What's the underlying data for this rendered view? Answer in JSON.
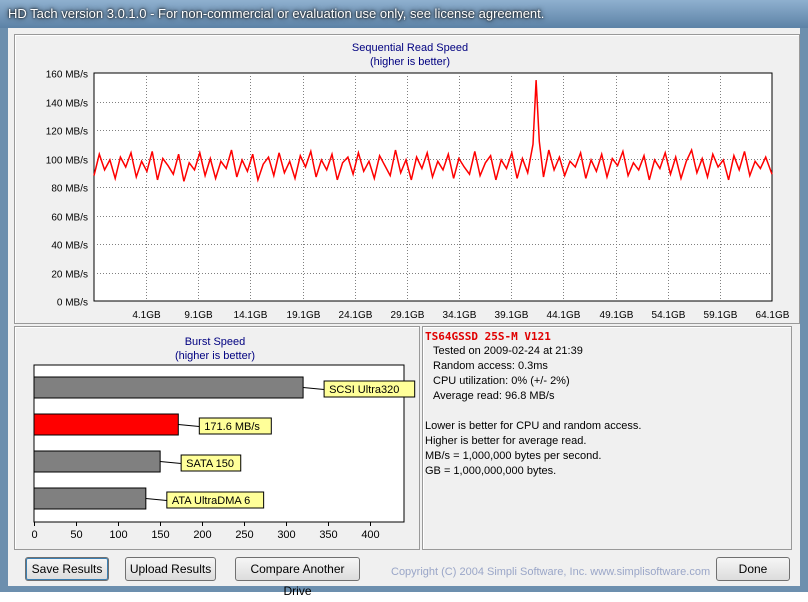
{
  "window": {
    "title": "HD Tach version 3.0.1.0  - For non-commercial or evaluation use only, see license agreement."
  },
  "seq_chart": {
    "title": "Sequential Read Speed",
    "subtitle": "(higher is better)"
  },
  "burst_chart": {
    "title": "Burst Speed",
    "subtitle": "(higher is better)"
  },
  "chart_data": [
    {
      "type": "line",
      "title": "Sequential Read Speed",
      "subtitle": "(higher is better)",
      "ylabel": "MB/s",
      "y_tick_labels": [
        "160 MB/s",
        "140 MB/s",
        "120 MB/s",
        "100 MB/s",
        "80 MB/s",
        "60 MB/s",
        "40 MB/s",
        "20 MB/s",
        "0 MB/s"
      ],
      "x_tick_labels": [
        "4.1GB",
        "9.1GB",
        "14.1GB",
        "19.1GB",
        "24.1GB",
        "29.1GB",
        "34.1GB",
        "39.1GB",
        "44.1GB",
        "49.1GB",
        "54.1GB",
        "59.1GB",
        "64.1GB"
      ],
      "ylim": [
        0,
        160
      ],
      "xlim": [
        0,
        64.1
      ],
      "grid": true,
      "series": [
        {
          "color": "#ff0000",
          "x_unit": "GB",
          "values": [
            {
              "x": 0.0,
              "y": 88
            },
            {
              "x": 0.5,
              "y": 103
            },
            {
              "x": 1.0,
              "y": 92
            },
            {
              "x": 1.5,
              "y": 99
            },
            {
              "x": 2.0,
              "y": 86
            },
            {
              "x": 2.5,
              "y": 101
            },
            {
              "x": 3.0,
              "y": 94
            },
            {
              "x": 3.5,
              "y": 104
            },
            {
              "x": 4.0,
              "y": 87
            },
            {
              "x": 4.5,
              "y": 98
            },
            {
              "x": 5.0,
              "y": 91
            },
            {
              "x": 5.5,
              "y": 105
            },
            {
              "x": 6.0,
              "y": 85
            },
            {
              "x": 6.5,
              "y": 100
            },
            {
              "x": 7.0,
              "y": 95
            },
            {
              "x": 7.5,
              "y": 89
            },
            {
              "x": 8.0,
              "y": 103
            },
            {
              "x": 8.5,
              "y": 84
            },
            {
              "x": 9.0,
              "y": 97
            },
            {
              "x": 9.5,
              "y": 92
            },
            {
              "x": 10.0,
              "y": 104
            },
            {
              "x": 10.5,
              "y": 88
            },
            {
              "x": 11.0,
              "y": 100
            },
            {
              "x": 11.5,
              "y": 86
            },
            {
              "x": 12.0,
              "y": 98
            },
            {
              "x": 12.5,
              "y": 93
            },
            {
              "x": 13.0,
              "y": 106
            },
            {
              "x": 13.5,
              "y": 87
            },
            {
              "x": 14.0,
              "y": 99
            },
            {
              "x": 14.5,
              "y": 91
            },
            {
              "x": 15.0,
              "y": 103
            },
            {
              "x": 15.5,
              "y": 85
            },
            {
              "x": 16.0,
              "y": 96
            },
            {
              "x": 16.5,
              "y": 101
            },
            {
              "x": 17.0,
              "y": 88
            },
            {
              "x": 17.5,
              "y": 104
            },
            {
              "x": 18.0,
              "y": 90
            },
            {
              "x": 18.5,
              "y": 98
            },
            {
              "x": 19.0,
              "y": 86
            },
            {
              "x": 19.5,
              "y": 102
            },
            {
              "x": 20.0,
              "y": 94
            },
            {
              "x": 20.5,
              "y": 105
            },
            {
              "x": 21.0,
              "y": 87
            },
            {
              "x": 21.5,
              "y": 99
            },
            {
              "x": 22.0,
              "y": 92
            },
            {
              "x": 22.5,
              "y": 103
            },
            {
              "x": 23.0,
              "y": 85
            },
            {
              "x": 23.5,
              "y": 97
            },
            {
              "x": 24.0,
              "y": 101
            },
            {
              "x": 24.5,
              "y": 89
            },
            {
              "x": 25.0,
              "y": 104
            },
            {
              "x": 25.5,
              "y": 91
            },
            {
              "x": 26.0,
              "y": 98
            },
            {
              "x": 26.5,
              "y": 86
            },
            {
              "x": 27.0,
              "y": 102
            },
            {
              "x": 27.5,
              "y": 95
            },
            {
              "x": 28.0,
              "y": 88
            },
            {
              "x": 28.5,
              "y": 106
            },
            {
              "x": 29.0,
              "y": 90
            },
            {
              "x": 29.5,
              "y": 99
            },
            {
              "x": 30.0,
              "y": 85
            },
            {
              "x": 30.5,
              "y": 101
            },
            {
              "x": 31.0,
              "y": 93
            },
            {
              "x": 31.5,
              "y": 104
            },
            {
              "x": 32.0,
              "y": 87
            },
            {
              "x": 32.5,
              "y": 98
            },
            {
              "x": 33.0,
              "y": 92
            },
            {
              "x": 33.5,
              "y": 103
            },
            {
              "x": 34.0,
              "y": 86
            },
            {
              "x": 34.5,
              "y": 100
            },
            {
              "x": 35.0,
              "y": 94
            },
            {
              "x": 35.5,
              "y": 89
            },
            {
              "x": 36.0,
              "y": 105
            },
            {
              "x": 36.5,
              "y": 88
            },
            {
              "x": 37.0,
              "y": 97
            },
            {
              "x": 37.5,
              "y": 102
            },
            {
              "x": 38.0,
              "y": 85
            },
            {
              "x": 38.5,
              "y": 99
            },
            {
              "x": 39.0,
              "y": 93
            },
            {
              "x": 39.5,
              "y": 104
            },
            {
              "x": 40.0,
              "y": 86
            },
            {
              "x": 40.5,
              "y": 100
            },
            {
              "x": 41.0,
              "y": 90
            },
            {
              "x": 41.5,
              "y": 110
            },
            {
              "x": 41.8,
              "y": 155
            },
            {
              "x": 42.1,
              "y": 112
            },
            {
              "x": 42.5,
              "y": 87
            },
            {
              "x": 43.0,
              "y": 106
            },
            {
              "x": 43.5,
              "y": 92
            },
            {
              "x": 44.0,
              "y": 101
            },
            {
              "x": 44.5,
              "y": 88
            },
            {
              "x": 45.0,
              "y": 98
            },
            {
              "x": 45.5,
              "y": 94
            },
            {
              "x": 46.0,
              "y": 104
            },
            {
              "x": 46.5,
              "y": 86
            },
            {
              "x": 47.0,
              "y": 99
            },
            {
              "x": 47.5,
              "y": 91
            },
            {
              "x": 48.0,
              "y": 103
            },
            {
              "x": 48.5,
              "y": 87
            },
            {
              "x": 49.0,
              "y": 100
            },
            {
              "x": 49.5,
              "y": 95
            },
            {
              "x": 50.0,
              "y": 105
            },
            {
              "x": 50.5,
              "y": 88
            },
            {
              "x": 51.0,
              "y": 97
            },
            {
              "x": 51.5,
              "y": 92
            },
            {
              "x": 52.0,
              "y": 102
            },
            {
              "x": 52.5,
              "y": 85
            },
            {
              "x": 53.0,
              "y": 99
            },
            {
              "x": 53.5,
              "y": 93
            },
            {
              "x": 54.0,
              "y": 104
            },
            {
              "x": 54.5,
              "y": 89
            },
            {
              "x": 55.0,
              "y": 101
            },
            {
              "x": 55.5,
              "y": 86
            },
            {
              "x": 56.0,
              "y": 98
            },
            {
              "x": 56.5,
              "y": 106
            },
            {
              "x": 57.0,
              "y": 90
            },
            {
              "x": 57.5,
              "y": 100
            },
            {
              "x": 58.0,
              "y": 87
            },
            {
              "x": 58.5,
              "y": 103
            },
            {
              "x": 59.0,
              "y": 94
            },
            {
              "x": 59.5,
              "y": 99
            },
            {
              "x": 60.0,
              "y": 85
            },
            {
              "x": 60.5,
              "y": 102
            },
            {
              "x": 61.0,
              "y": 92
            },
            {
              "x": 61.5,
              "y": 105
            },
            {
              "x": 62.0,
              "y": 88
            },
            {
              "x": 62.5,
              "y": 98
            },
            {
              "x": 63.0,
              "y": 93
            },
            {
              "x": 63.5,
              "y": 101
            },
            {
              "x": 64.1,
              "y": 89
            }
          ]
        }
      ]
    },
    {
      "type": "bar",
      "orientation": "horizontal",
      "title": "Burst Speed",
      "subtitle": "(higher is better)",
      "x_tick_labels": [
        "0",
        "50",
        "100",
        "150",
        "200",
        "250",
        "300",
        "350",
        "400"
      ],
      "xlim": [
        0,
        440
      ],
      "grid": false,
      "bars": [
        {
          "label": "SCSI Ultra320",
          "value": 320,
          "color": "#808080"
        },
        {
          "label": "171.6 MB/s",
          "value": 171.6,
          "color": "#ff0000"
        },
        {
          "label": "SATA 150",
          "value": 150,
          "color": "#808080"
        },
        {
          "label": "ATA UltraDMA 6",
          "value": 133,
          "color": "#808080"
        }
      ]
    }
  ],
  "info": {
    "drive_name": "TS64GSSD 25S-M V121",
    "tested_on": "Tested on 2009-02-24 at 21:39",
    "random_access": "Random access: 0.3ms",
    "cpu_util": "CPU utilization: 0% (+/- 2%)",
    "avg_read": "Average read: 96.8 MB/s",
    "note1": "Lower is better for CPU and random access.",
    "note2": "Higher is better for average read.",
    "note3": "MB/s = 1,000,000 bytes per second.",
    "note4": "GB = 1,000,000,000 bytes."
  },
  "buttons": {
    "save": "Save Results",
    "upload": "Upload Results",
    "compare": "Compare Another Drive",
    "done": "Done"
  },
  "footer": {
    "copyright": "Copyright (C) 2004 Simpli Software, Inc. www.simplisoftware.com"
  },
  "colors": {
    "line": "#ff0000",
    "grid": "#808080",
    "title_text": "#000080",
    "bar_label_bg": "#ffff99"
  }
}
